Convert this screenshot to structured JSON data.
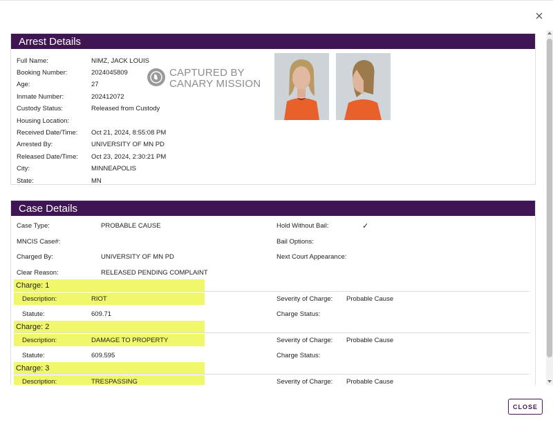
{
  "dialog": {
    "close_icon": "close-x-icon",
    "close_button_label": "CLOSE"
  },
  "arrest": {
    "title": "Arrest Details",
    "rows": [
      {
        "label": "Full Name:",
        "value": "NIMZ, JACK LOUIS"
      },
      {
        "label": "Booking Number:",
        "value": "2024045809"
      },
      {
        "label": "Age:",
        "value": "27"
      },
      {
        "label": "Inmate Number:",
        "value": "202412072"
      },
      {
        "label": "Custody Status:",
        "value": "Released from Custody"
      },
      {
        "label": "Housing Location:",
        "value": ""
      },
      {
        "label": "Received Date/Time:",
        "value": "Oct 21, 2024, 8:55:08 PM"
      },
      {
        "label": "Arrested By:",
        "value": "UNIVERSITY OF MN PD"
      },
      {
        "label": "Released Date/Time:",
        "value": "Oct 23, 2024, 2:30:21 PM"
      },
      {
        "label": "City:",
        "value": "MINNEAPOLIS"
      },
      {
        "label": "State:",
        "value": "MN"
      }
    ],
    "watermark": {
      "line1": "CAPTURED BY",
      "line2": "CANARY MISSION"
    },
    "photos": [
      "front-mugshot",
      "profile-mugshot"
    ]
  },
  "case": {
    "title": "Case Details",
    "left_rows": [
      {
        "label": "Case Type:",
        "value": "PROBABLE CAUSE"
      },
      {
        "label": "MNCIS Case#:",
        "value": ""
      },
      {
        "label": "Charged By:",
        "value": "UNIVERSITY OF MN PD"
      },
      {
        "label": "Clear Reason:",
        "value": "RELEASED PENDING COMPLAINT"
      }
    ],
    "right_rows": [
      {
        "label": "Hold Without Bail:",
        "value": "✓"
      },
      {
        "label": "Bail Options:",
        "value": ""
      },
      {
        "label": "Next Court Appearance:",
        "value": ""
      }
    ],
    "charges": [
      {
        "title": "Charge: 1",
        "desc_label": "Description:",
        "description": "RIOT",
        "statute_label": "Statute:",
        "statute": "609.71",
        "severity_label": "Severity of Charge:",
        "severity": "Probable Cause",
        "status_label": "Charge Status:",
        "status": ""
      },
      {
        "title": "Charge: 2",
        "desc_label": "Description:",
        "description": "DAMAGE TO PROPERTY",
        "statute_label": "Statute:",
        "statute": "609.595",
        "severity_label": "Severity of Charge:",
        "severity": "Probable Cause",
        "status_label": "Charge Status:",
        "status": ""
      },
      {
        "title": "Charge: 3",
        "desc_label": "Description:",
        "description": "TRESPASSING",
        "severity_label": "Severity of Charge:",
        "severity": "Probable Cause"
      }
    ]
  },
  "colors": {
    "header": "#3f1653",
    "highlight": "#f0f76a"
  }
}
